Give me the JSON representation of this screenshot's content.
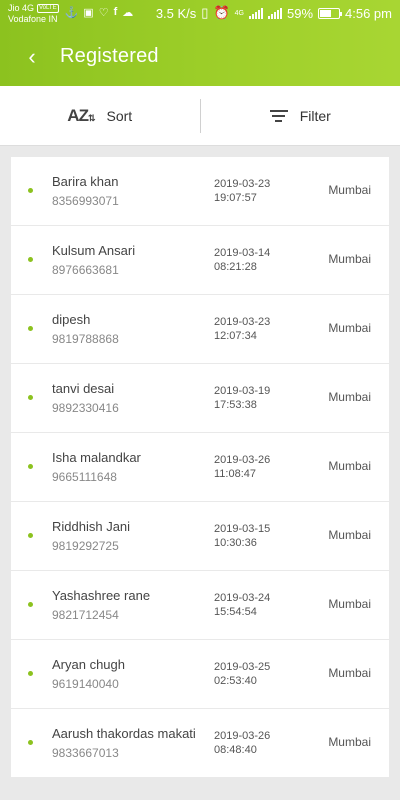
{
  "status": {
    "carrier1": "Jio 4G",
    "volte": "VoLTE",
    "carrier2": "Vodafone IN",
    "speed": "3.5 K/s",
    "network_type": "4G",
    "battery": "59%",
    "battery_level": 0.59,
    "time": "4:56 pm",
    "icons": [
      "usb-icon",
      "camera-icon",
      "heart-icon",
      "facebook-icon",
      "cloud-icon"
    ]
  },
  "appbar": {
    "back_icon": "back-arrow-icon",
    "title": "Registered"
  },
  "toolbar": {
    "sort_icon": "AZ",
    "sort_label": "Sort",
    "filter_label": "Filter"
  },
  "accent": "#8cc21f",
  "rows": [
    {
      "name": "Barira khan",
      "phone": "8356993071",
      "date": "2019-03-23",
      "time": "19:07:57",
      "city": "Mumbai"
    },
    {
      "name": "Kulsum Ansari",
      "phone": "8976663681",
      "date": "2019-03-14",
      "time": "08:21:28",
      "city": "Mumbai"
    },
    {
      "name": "dipesh",
      "phone": "9819788868",
      "date": "2019-03-23",
      "time": "12:07:34",
      "city": "Mumbai"
    },
    {
      "name": "tanvi desai",
      "phone": "9892330416",
      "date": "2019-03-19",
      "time": "17:53:38",
      "city": "Mumbai"
    },
    {
      "name": "Isha malandkar",
      "phone": "9665111648",
      "date": "2019-03-26",
      "time": "11:08:47",
      "city": "Mumbai"
    },
    {
      "name": "Riddhish Jani",
      "phone": "9819292725",
      "date": "2019-03-15",
      "time": "10:30:36",
      "city": "Mumbai"
    },
    {
      "name": "Yashashree rane",
      "phone": "9821712454",
      "date": "2019-03-24",
      "time": "15:54:54",
      "city": "Mumbai"
    },
    {
      "name": "Aryan chugh",
      "phone": "9619140040",
      "date": "2019-03-25",
      "time": "02:53:40",
      "city": "Mumbai"
    },
    {
      "name": "Aarush thakordas makati",
      "phone": "9833667013",
      "date": "2019-03-26",
      "time": "08:48:40",
      "city": "Mumbai"
    }
  ]
}
